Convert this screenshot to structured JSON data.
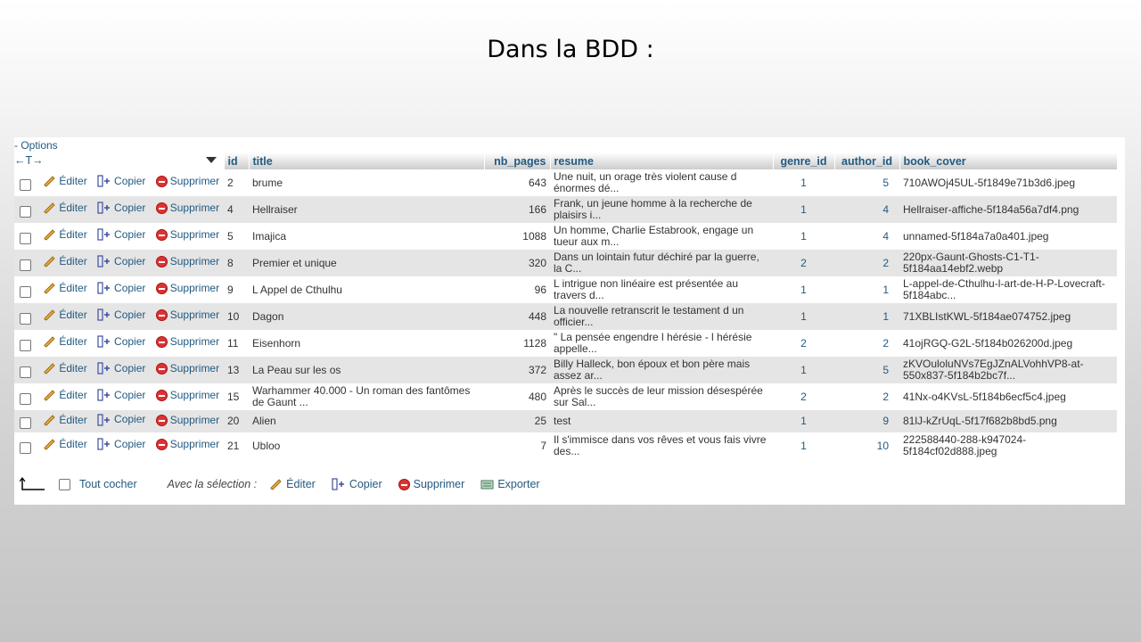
{
  "slide_title": "Dans la BDD :",
  "options_label": "- Options",
  "sort_arrows": "←T→",
  "columns": [
    "id",
    "title",
    "nb_pages",
    "resume",
    "genre_id",
    "author_id",
    "book_cover"
  ],
  "row_actions": {
    "edit": "Éditer",
    "copy": "Copier",
    "delete": "Supprimer"
  },
  "rows": [
    {
      "id": "2",
      "title": "brume",
      "nb_pages": "643",
      "resume": "Une nuit, un orage très violent cause d énormes dé...",
      "genre_id": "1",
      "author_id": "5",
      "book_cover": "710AWOj45UL-5f1849e71b3d6.jpeg"
    },
    {
      "id": "4",
      "title": "Hellraiser",
      "nb_pages": "166",
      "resume": "Frank, un jeune homme à la recherche de plaisirs i...",
      "genre_id": "1",
      "author_id": "4",
      "book_cover": "Hellraiser-affiche-5f184a56a7df4.png"
    },
    {
      "id": "5",
      "title": "Imajica",
      "nb_pages": "1088",
      "resume": "Un homme, Charlie Estabrook, engage un tueur aux m...",
      "genre_id": "1",
      "author_id": "4",
      "book_cover": "unnamed-5f184a7a0a401.jpeg"
    },
    {
      "id": "8",
      "title": "Premier et unique",
      "nb_pages": "320",
      "resume": "Dans un lointain futur déchiré par la guerre, la C...",
      "genre_id": "2",
      "author_id": "2",
      "book_cover": "220px-Gaunt-Ghosts-C1-T1-5f184aa14ebf2.webp"
    },
    {
      "id": "9",
      "title": "L Appel de Cthulhu",
      "nb_pages": "96",
      "resume": "L intrigue non linéaire est présentée au travers d...",
      "genre_id": "1",
      "author_id": "1",
      "book_cover": "L-appel-de-Cthulhu-l-art-de-H-P-Lovecraft-5f184abc..."
    },
    {
      "id": "10",
      "title": "Dagon",
      "nb_pages": "448",
      "resume": "La nouvelle retranscrit le testament d un officier...",
      "genre_id": "1",
      "author_id": "1",
      "book_cover": "71XBLIstKWL-5f184ae074752.jpeg"
    },
    {
      "id": "11",
      "title": "Eisenhorn",
      "nb_pages": "1128",
      "resume": "\" La pensée engendre l hérésie - l hérésie appelle...",
      "genre_id": "2",
      "author_id": "2",
      "book_cover": "41ojRGQ-G2L-5f184b026200d.jpeg"
    },
    {
      "id": "13",
      "title": "La Peau sur les os",
      "nb_pages": "372",
      "resume": "Billy Halleck, bon époux et bon père mais assez ar...",
      "genre_id": "1",
      "author_id": "5",
      "book_cover": "zKVOuloluNVs7EgJZnALVohhVP8-at-550x837-5f184b2bc7f..."
    },
    {
      "id": "15",
      "title": "Warhammer 40.000 - Un roman des fantômes de Gaunt ...",
      "nb_pages": "480",
      "resume": "Après le succès de leur mission désespérée sur Sal...",
      "genre_id": "2",
      "author_id": "2",
      "book_cover": "41Nx-o4KVsL-5f184b6ecf5c4.jpeg"
    },
    {
      "id": "20",
      "title": "Alien",
      "nb_pages": "25",
      "resume": "test",
      "genre_id": "1",
      "author_id": "9",
      "book_cover": "81lJ-kZrUqL-5f17f682b8bd5.png"
    },
    {
      "id": "21",
      "title": "Ubloo",
      "nb_pages": "7",
      "resume": "Il s'immisce dans vos rêves et vous fais vivre des...",
      "genre_id": "1",
      "author_id": "10",
      "book_cover": "222588440-288-k947024-5f184cf02d888.jpeg"
    }
  ],
  "footer": {
    "check_all": "Tout cocher",
    "with_selection": "Avec la sélection :",
    "edit": "Éditer",
    "copy": "Copier",
    "delete": "Supprimer",
    "export": "Exporter"
  }
}
